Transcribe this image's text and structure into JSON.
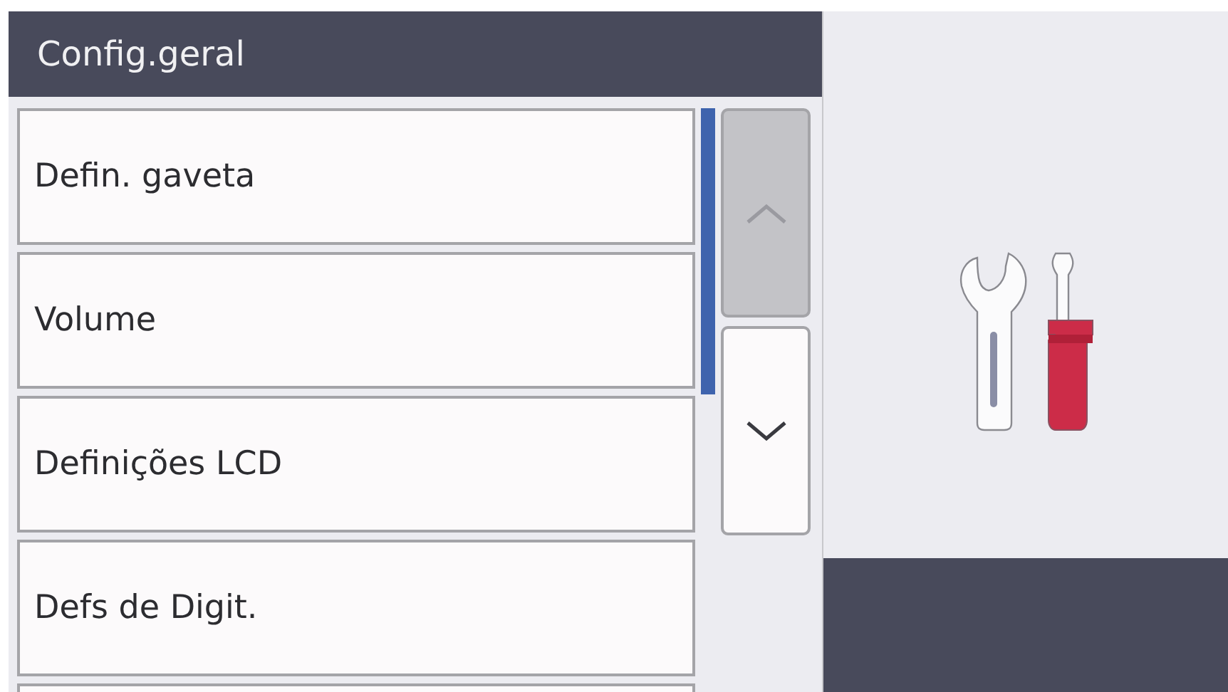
{
  "header": {
    "title": "Config.geral"
  },
  "menu_items": [
    {
      "label": "Defin. gaveta"
    },
    {
      "label": "Volume"
    },
    {
      "label": "Definições LCD"
    },
    {
      "label": "Defs de Digit."
    }
  ],
  "scroll_buttons": [
    {
      "kind": "up",
      "disabled": true
    },
    {
      "kind": "down",
      "disabled": false
    }
  ]
}
